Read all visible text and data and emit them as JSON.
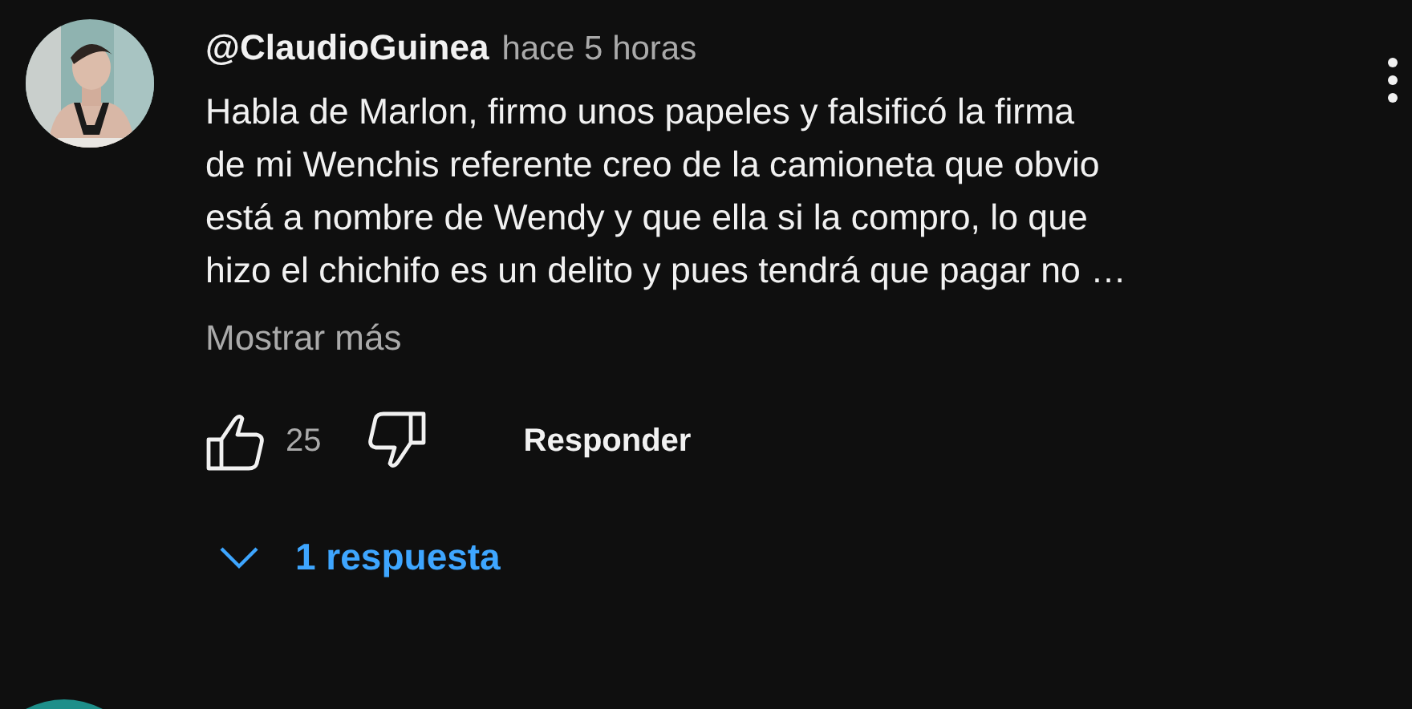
{
  "comment": {
    "author": "@ClaudioGuinea",
    "time": "hace 5 horas",
    "text": "Habla de Marlon, firmo unos papeles y falsificó la firma\nde mi Wenchis referente creo de la camioneta que obvio\nestá a nombre de Wendy y que ella si la compro, lo que\nhizo el chichifo es un delito y pues tendrá que pagar no …",
    "show_more": "Mostrar más",
    "like_count": "25",
    "liked": false,
    "disliked": false,
    "reply_button": "Responder",
    "replies": {
      "label": "1 respuesta",
      "expanded": false
    }
  }
}
